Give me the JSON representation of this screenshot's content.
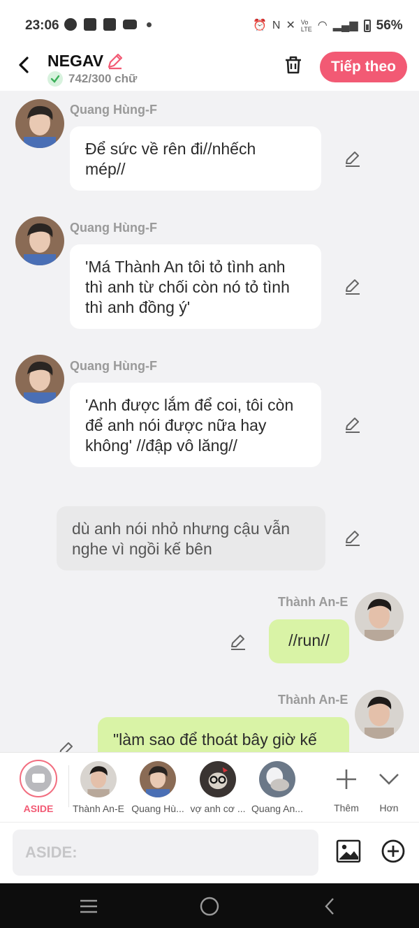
{
  "status_bar": {
    "time": "23:06",
    "battery": "56%",
    "left_icons": [
      "facebook-icon",
      "heart-app-icon",
      "mail-app-icon",
      "youtube-icon"
    ],
    "right_icons": [
      "alarm-icon",
      "nfc-icon",
      "mute-icon",
      "volte-icon",
      "wifi-icon",
      "signal-icon",
      "battery-icon"
    ]
  },
  "header": {
    "title": "NEGAV",
    "word_count": "742/300 chữ",
    "next_label": "Tiếp theo",
    "accent_color": "#f25a74"
  },
  "messages": [
    {
      "sender": "Quang Hùng-F",
      "line1": "Để sức về rên đi//nhếch",
      "line2": "mép//",
      "line3": ""
    },
    {
      "sender": "Quang Hùng-F",
      "line1": "'Má Thành An tôi tỏ tình anh",
      "line2": "thì anh từ chối còn nó tỏ tình",
      "line3": "thì anh đồng ý'"
    },
    {
      "sender": "Quang Hùng-F",
      "line1": "'Anh được lắm để coi, tôi còn",
      "line2": "để anh nói được nữa hay",
      "line3": "không' //đập vô lăng//"
    },
    {
      "sender": "",
      "line1": "dù anh nói nhỏ nhưng cậu vẫn",
      "line2": "nghe vì ngồi kế bên",
      "line3": ""
    },
    {
      "sender": "Thành An-E",
      "line1": "//run//",
      "line2": "",
      "line3": ""
    },
    {
      "sender": "Thành An-E",
      "line1": "\"làm sao để thoát bây giờ kế",
      "line2": "",
      "line3": ""
    }
  ],
  "characters": [
    {
      "label": "ASIDE"
    },
    {
      "label": "Thành An-E"
    },
    {
      "label": "Quang Hù..."
    },
    {
      "label": "vợ anh cơ ..."
    },
    {
      "label": "Quang An..."
    },
    {
      "label": "Thêm"
    },
    {
      "label": "Hơn"
    }
  ],
  "input": {
    "placeholder": "ASIDE:"
  }
}
